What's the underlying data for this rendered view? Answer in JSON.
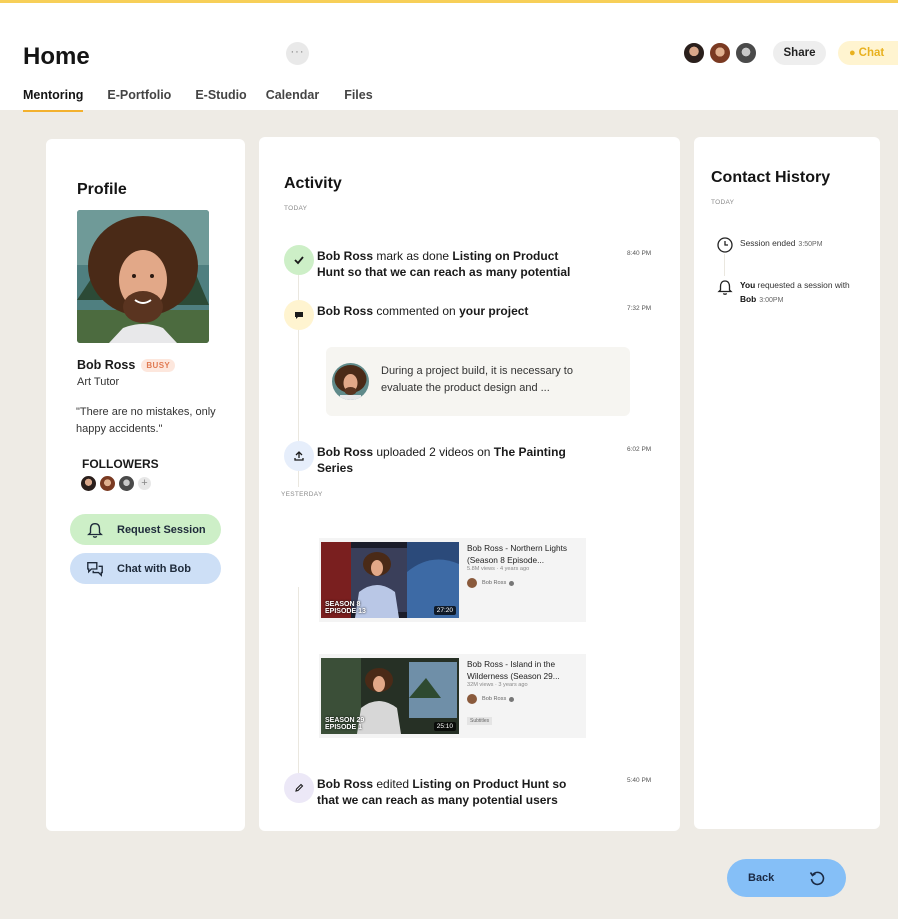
{
  "header": {
    "title": "Home",
    "more_label": "···",
    "tabs": [
      {
        "label": "Mentoring",
        "active": true
      },
      {
        "label": "E-Portfolio"
      },
      {
        "label": "E-Studio"
      },
      {
        "label": "Calendar"
      },
      {
        "label": "Files"
      }
    ],
    "share_label": "Share",
    "chat_label": "Chat"
  },
  "profile": {
    "title": "Profile",
    "name": "Bob Ross",
    "status": "BUSY",
    "role": "Art Tutor",
    "quote": "\"There are no mistakes, only happy accidents.\"",
    "followers_label": "FOLLOWERS",
    "followers_more": "+",
    "request_label": "Request Session",
    "chat_label": "Chat with Bob"
  },
  "activity": {
    "title": "Activity",
    "today_label": "TODAY",
    "yesterday_label": "YESTERDAY",
    "items": [
      {
        "actor": "Bob Ross",
        "action": " mark as done ",
        "target": "Listing on Product Hunt so that we can reach as many potential",
        "time": "8:40 PM"
      },
      {
        "actor": "Bob Ross",
        "action": " commented on ",
        "target": "your project",
        "time": "7:32 PM",
        "comment": "During a project build, it is necessary to evaluate the product design and ..."
      },
      {
        "actor": "Bob Ross",
        "action": " uploaded 2 videos on ",
        "target": "The Painting Series",
        "time": "6:02 PM"
      },
      {
        "actor": "Bob Ross",
        "action": " edited ",
        "target": "Listing on Product Hunt so that we can reach as many potential users",
        "time": "5:40 PM"
      }
    ],
    "videos": [
      {
        "title": "Bob Ross - Northern Lights (Season 8 Episode...",
        "meta": "5.8M views · 4 years ago",
        "channel": "Bob Ross",
        "duration": "27:20",
        "season": "SEASON 8\nEPISODE 13"
      },
      {
        "title": "Bob Ross - Island in the Wilderness (Season 29...",
        "meta": "32M views · 3 years ago",
        "channel": "Bob Ross",
        "duration": "25:10",
        "season": "SEASON 29\nEPISODE 1",
        "badge": "Subtitles"
      }
    ]
  },
  "contact": {
    "title": "Contact History",
    "today_label": "TODAY",
    "items": [
      {
        "text": "Session ended",
        "time": "3:50PM"
      },
      {
        "you": "You",
        "text": " requested a session with ",
        "who": "Bob",
        "time": "3:00PM"
      }
    ]
  },
  "footer": {
    "back_label": "Back"
  },
  "colors": {
    "accent": "#f3b12e",
    "busy": "#e07a52",
    "request_bg": "#cdefc7",
    "chat_bg": "#cddff6",
    "back_bg": "#85bff7"
  }
}
